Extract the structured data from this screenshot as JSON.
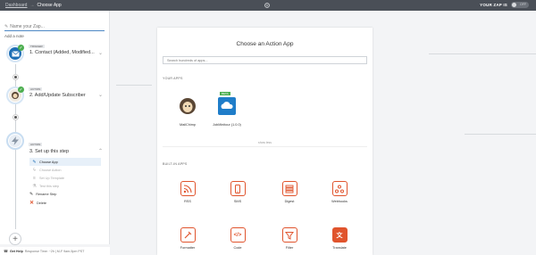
{
  "topbar": {
    "breadcrumb_root": "Dashboard",
    "breadcrumb_arrow": "→",
    "breadcrumb_current": "Choose App",
    "zap_status_label": "YOUR ZAP IS",
    "toggle_text": "OFF"
  },
  "sidebar": {
    "zap_name_placeholder": "Name your Zap...",
    "add_note": "Add a note",
    "steps": [
      {
        "badge": "TRIGGER",
        "title": "1. Contact (Added, Modified..."
      },
      {
        "badge": "ACTION",
        "title": "2. Add/Update Subscriber"
      },
      {
        "badge": "ACTION",
        "title": "3. Set up this step"
      }
    ],
    "substeps": [
      {
        "icon": "pencil-icon",
        "label": "Choose App"
      },
      {
        "icon": "bolt-icon",
        "label": "Choose Action"
      },
      {
        "icon": "list-icon",
        "label": "Set Up Template"
      },
      {
        "icon": "flask-icon",
        "label": "Test this step"
      }
    ],
    "rename_label": "Rename Step",
    "delete_label": "Delete",
    "footer_help": "Get Help",
    "footer_info": "Response Time: ~2h | M-F 9am-5pm PST"
  },
  "panel": {
    "title": "Choose an Action App",
    "search_placeholder": "Search hundreds of apps...",
    "your_apps_label": "YOUR APPS",
    "your_apps": [
      {
        "name": "MailChimp",
        "icon": "mailchimp-logo"
      },
      {
        "name": "JobMinitour (1.0.0)",
        "icon": "cloud-logo",
        "badge": "BETA"
      }
    ],
    "show_less": "show less",
    "built_in_label": "BUILT-IN APPS",
    "built_in_apps": [
      {
        "name": "RSS",
        "icon": "rss-icon"
      },
      {
        "name": "SMS",
        "icon": "sms-icon"
      },
      {
        "name": "Digest",
        "icon": "digest-icon"
      },
      {
        "name": "Webhooks",
        "icon": "webhooks-icon"
      },
      {
        "name": "Formatter",
        "icon": "formatter-icon"
      },
      {
        "name": "Code",
        "icon": "code-icon"
      },
      {
        "name": "Filter",
        "icon": "filter-icon"
      },
      {
        "name": "Translate",
        "icon": "translate-icon"
      }
    ]
  },
  "colors": {
    "accent": "#e0542d",
    "topbar": "#4a4f57",
    "link": "#4d88c4",
    "success": "#4cae4f"
  }
}
